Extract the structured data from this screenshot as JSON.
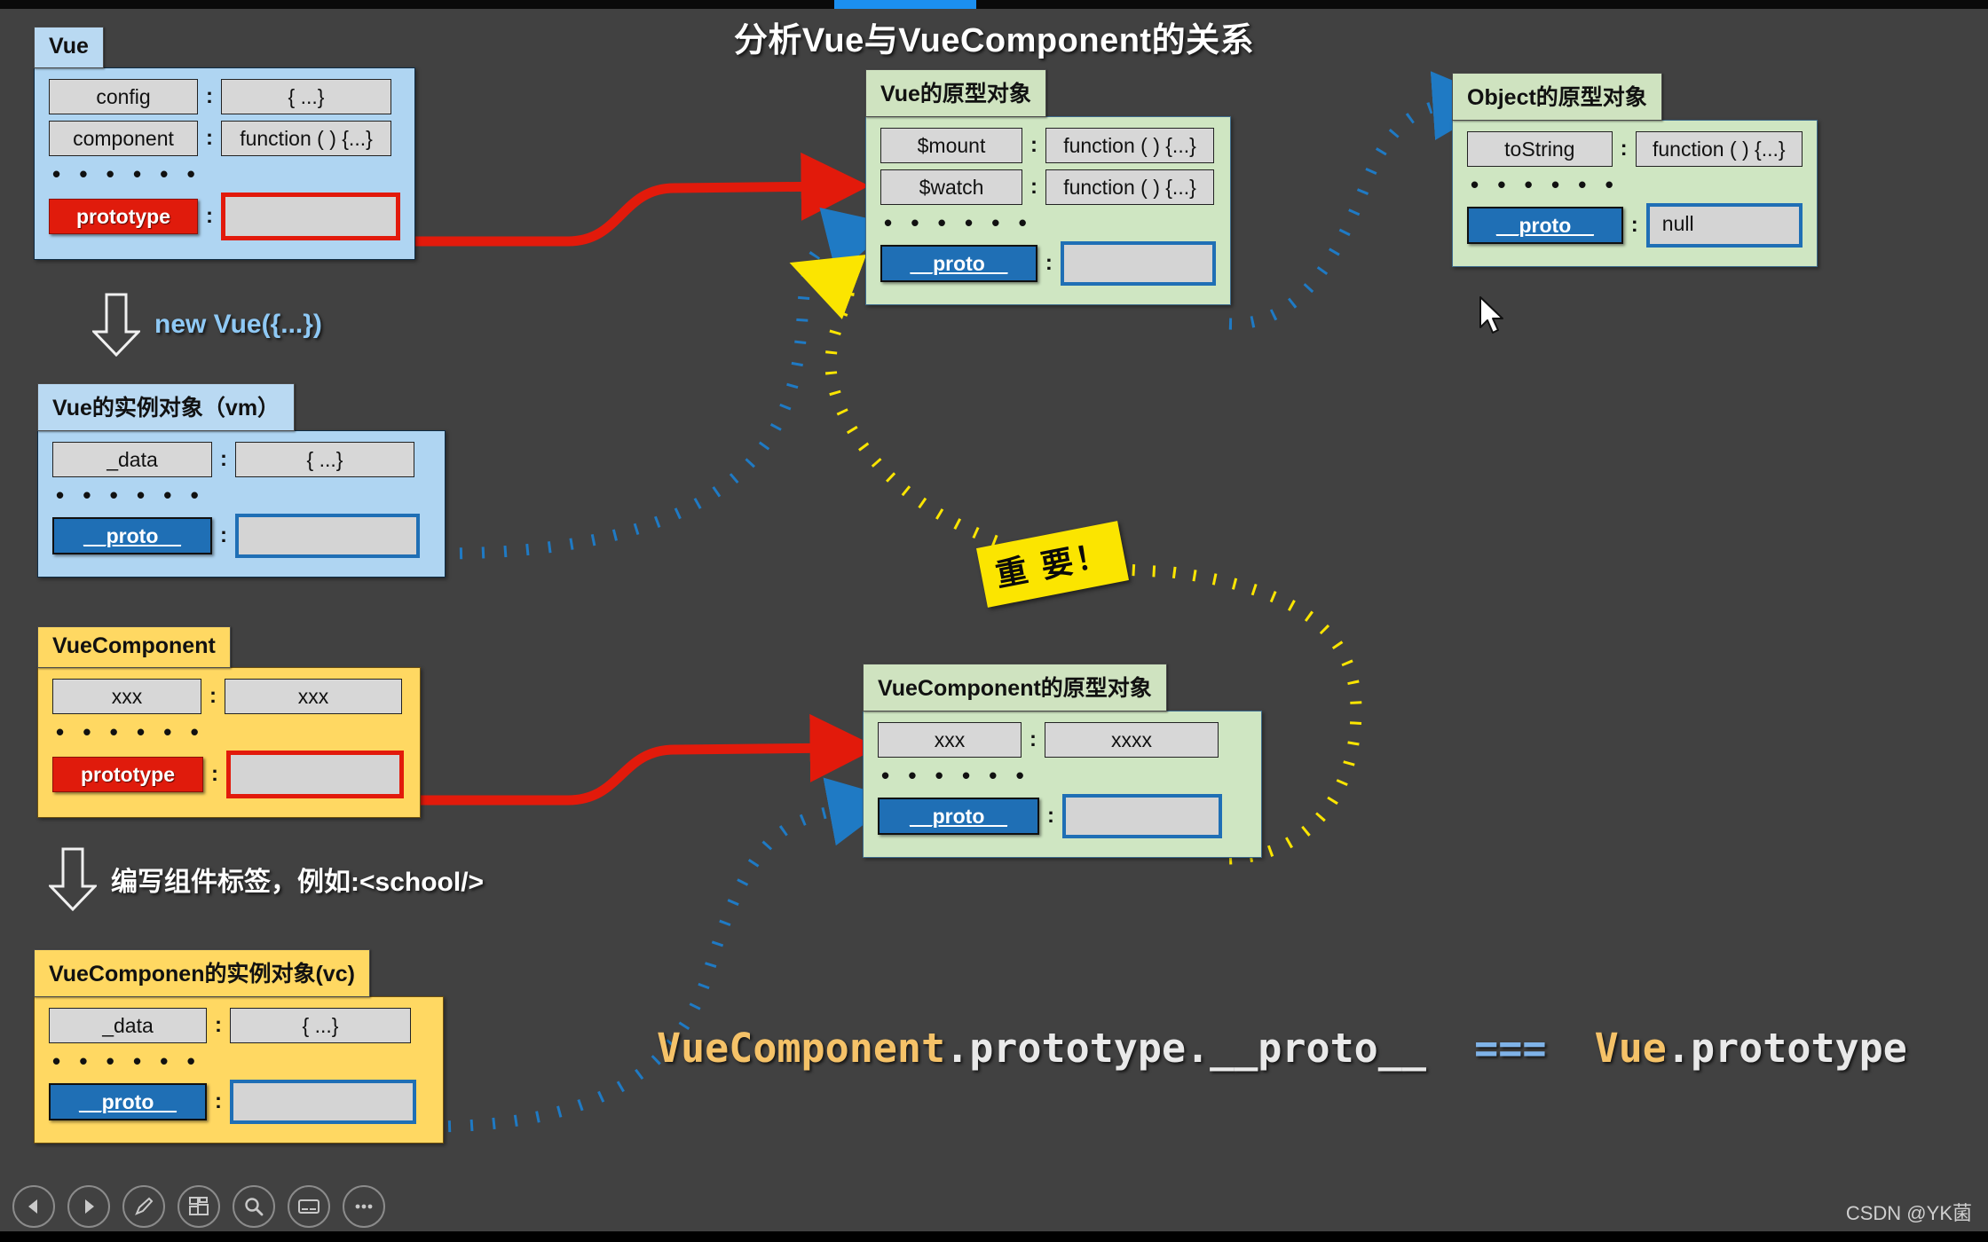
{
  "title": "分析Vue与VueComponent的关系",
  "player": {
    "progress_played_label": "",
    "toolbar": [
      {
        "icon": "previous-icon",
        "label": "上一页"
      },
      {
        "icon": "play-icon",
        "label": "播放"
      },
      {
        "icon": "pen-icon",
        "label": "画笔"
      },
      {
        "icon": "layout-icon",
        "label": "布局"
      },
      {
        "icon": "search-icon",
        "label": "搜索"
      },
      {
        "icon": "subtitle-icon",
        "label": "字幕"
      },
      {
        "icon": "more-icon",
        "label": "更多"
      }
    ],
    "watermark": "CSDN @YK菌"
  },
  "cards": {
    "vue": {
      "tab": "Vue",
      "theme": "blue",
      "rows": [
        {
          "key": "config",
          "value": "{ ...}"
        },
        {
          "key": "component",
          "value": "function ( ) {...}"
        }
      ],
      "ellipsis": "• • • • • •",
      "special": {
        "key": "prototype",
        "value": ""
      }
    },
    "vue_prototype": {
      "tab": "Vue的原型对象",
      "theme": "green",
      "rows": [
        {
          "key": "$mount",
          "value": "function ( ) {...}"
        },
        {
          "key": "$watch",
          "value": "function ( ) {...}"
        }
      ],
      "ellipsis": "• • • • • •",
      "special": {
        "key": "__proto__",
        "value": ""
      }
    },
    "object_prototype": {
      "tab": "Object的原型对象",
      "theme": "green",
      "rows": [
        {
          "key": "toString",
          "value": "function ( ) {...}"
        }
      ],
      "ellipsis": "• • • • • •",
      "special": {
        "key": "__proto__",
        "value": "null"
      }
    },
    "vm": {
      "tab": "Vue的实例对象（vm）",
      "theme": "blue",
      "rows": [
        {
          "key": "_data",
          "value": "{ ...}"
        }
      ],
      "ellipsis": "• • • • • •",
      "special": {
        "key": "__proto__",
        "value": ""
      }
    },
    "vuecomponent": {
      "tab": "VueComponent",
      "theme": "yellow",
      "rows": [
        {
          "key": "xxx",
          "value": "xxx"
        }
      ],
      "ellipsis": "• • • • • •",
      "special": {
        "key": "prototype",
        "value": ""
      }
    },
    "vuecomponent_prototype": {
      "tab": "VueComponent的原型对象",
      "theme": "green",
      "rows": [
        {
          "key": "xxx",
          "value": "xxxx"
        }
      ],
      "ellipsis": "• • • • • •",
      "special": {
        "key": "__proto__",
        "value": ""
      }
    },
    "vc": {
      "tab": "VueComponen的实例对象(vc)",
      "theme": "yellow",
      "rows": [
        {
          "key": "_data",
          "value": "{ ...}"
        }
      ],
      "ellipsis": "• • • • • •",
      "special": {
        "key": "__proto__",
        "value": ""
      }
    }
  },
  "steps": {
    "new_vue": "new Vue({...})",
    "write_tag": "编写组件标签，例如:<school/>"
  },
  "sticker": {
    "important": "重 要！"
  },
  "equation": {
    "left_ident": "VueComponent",
    "left_rest": ".prototype.__proto__",
    "operator": "===",
    "right_ident": "Vue",
    "right_rest": ".prototype",
    "full": "VueComponent.prototype.__proto__ === Vue.prototype"
  },
  "colors": {
    "background": "#414141",
    "blue_card": "#afd5f2",
    "green_card": "#cfe6c2",
    "yellow_card": "#ffd862",
    "red_accent": "#e21a0b",
    "blue_accent": "#1f6fb5",
    "yellow_accent": "#fbe500",
    "title_text": "#ffffff"
  }
}
